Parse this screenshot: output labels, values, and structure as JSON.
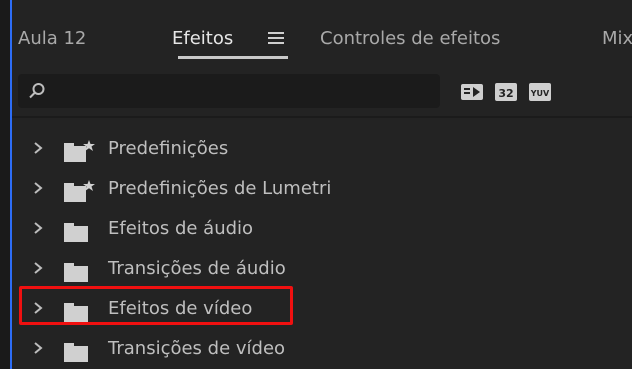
{
  "tabs": [
    {
      "label": "Aula 12"
    },
    {
      "label": "Efeitos",
      "active": true
    },
    {
      "label": "Controles de efeitos"
    },
    {
      "label": "Mix"
    }
  ],
  "search": {
    "value": "",
    "placeholder": ""
  },
  "toolbar": {
    "icons": [
      "accelerated-effects-icon",
      "32-bit-color-icon",
      "yuv-effects-icon"
    ],
    "icon_texts": [
      "32",
      "YUV"
    ]
  },
  "effects_list": [
    {
      "label": "Predefinições",
      "icon": "preset-folder-star-icon"
    },
    {
      "label": "Predefinições de Lumetri",
      "icon": "preset-folder-star-icon"
    },
    {
      "label": "Efeitos de áudio",
      "icon": "folder-icon"
    },
    {
      "label": "Transições de áudio",
      "icon": "folder-icon"
    },
    {
      "label": "Efeitos de vídeo",
      "icon": "folder-icon",
      "highlighted": true
    },
    {
      "label": "Transições de vídeo",
      "icon": "folder-icon"
    }
  ],
  "colors": {
    "panel_bg": "#232323",
    "accent_blue": "#2d6df6",
    "highlight_red": "#f01010"
  }
}
